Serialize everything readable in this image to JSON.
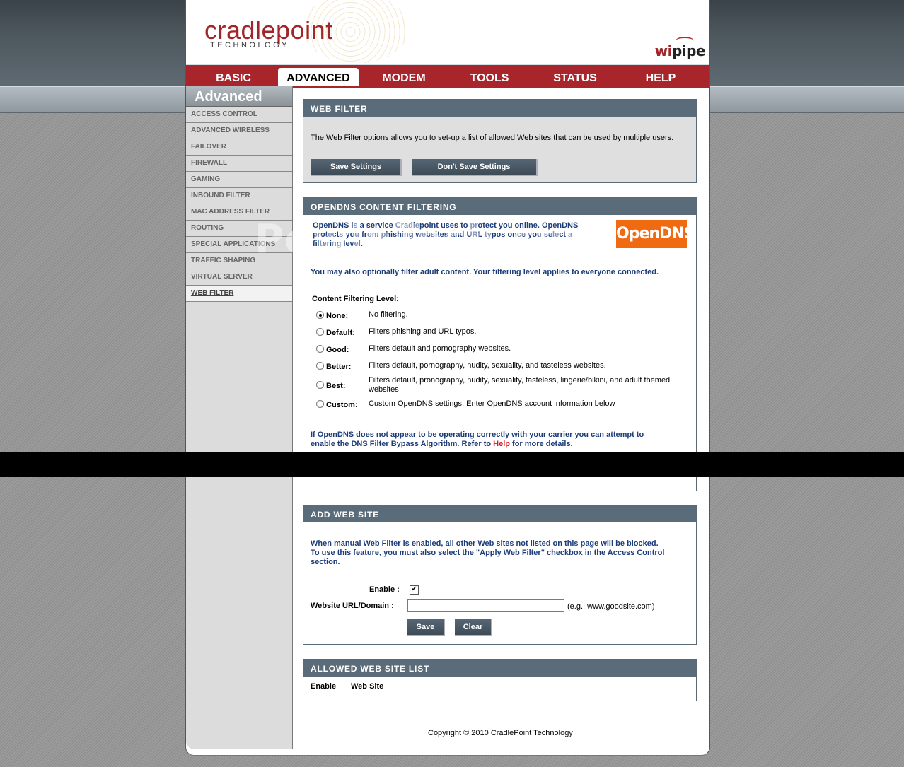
{
  "brand": {
    "logo_main": "cradlepoint",
    "logo_sub": "TECHNOLOGY",
    "product_wi": "wi",
    "product_rest": "pipe"
  },
  "nav": {
    "tabs": [
      "BASIC",
      "ADVANCED",
      "MODEM",
      "TOOLS",
      "STATUS",
      "HELP"
    ],
    "active": "ADVANCED"
  },
  "sidebar": {
    "title": "Advanced",
    "items": [
      "ACCESS CONTROL",
      "ADVANCED WIRELESS",
      "FAILOVER",
      "FIREWALL",
      "GAMING",
      "INBOUND FILTER",
      "MAC ADDRESS FILTER",
      "ROUTING",
      "SPECIAL APPLICATIONS",
      "TRAFFIC SHAPING",
      "VIRTUAL SERVER",
      "WEB FILTER"
    ],
    "current": "WEB FILTER"
  },
  "web_filter": {
    "title": "WEB FILTER",
    "description": "The Web Filter options allows you to set-up a list of allowed Web sites that can be used by multiple users.",
    "save_label": "Save Settings",
    "dont_save_label": "Don't Save Settings"
  },
  "opendns": {
    "title": "OPENDNS CONTENT FILTERING",
    "intro_1": "OpenDNS is a service Cradlepoint uses to protect you online. OpenDNS",
    "intro_2": "protects you from phishing websites and URL typos once you select a",
    "intro_3": "filtering level.",
    "logo_text": "OpenDNS",
    "adult_note": "You may also optionally filter adult content. Your filtering level applies to everyone connected.",
    "level_label": "Content Filtering Level:",
    "levels": [
      {
        "name": "None:",
        "desc": "No filtering.",
        "selected": true
      },
      {
        "name": "Default:",
        "desc": "Filters phishing and URL typos.",
        "selected": false
      },
      {
        "name": "Good:",
        "desc": "Filters default and pornography websites.",
        "selected": false
      },
      {
        "name": "Better:",
        "desc": "Filters default, pornography, nudity, sexuality, and tasteless websites.",
        "selected": false
      },
      {
        "name": "Best:",
        "desc": "Filters default, pronography, nudity, sexuality, tasteless, lingerie/bikini, and adult themed",
        "desc_2": "websites",
        "selected": false
      },
      {
        "name": "Custom:",
        "desc": "Custom OpenDNS settings. Enter OpenDNS account information below",
        "selected": false
      }
    ],
    "bypass_1": "If OpenDNS does not appear to be operating correctly with your carrier you can attempt to",
    "bypass_2_pre": "enable the DNS Filter Bypass Algorithm. Refer to ",
    "bypass_help": "Help",
    "bypass_2_post": " for more details."
  },
  "add_site": {
    "title": "ADD WEB SITE",
    "note_1": "When manual Web Filter is enabled, all other Web sites not listed on this page will be blocked.",
    "note_2": "To use this feature, you must also select the \"Apply Web Filter\" checkbox in the Access Control",
    "note_3": "section.",
    "enable_label": "Enable :",
    "enable_checked": true,
    "url_label": "Website URL/Domain :",
    "url_value": "",
    "url_hint": "(e.g.: www.goodsite.com)",
    "save_label": "Save",
    "clear_label": "Clear"
  },
  "allowed_list": {
    "title": "ALLOWED WEB SITE LIST",
    "col_enable": "Enable",
    "col_site": "Web Site"
  },
  "footer": {
    "copyright": "Copyright © 2010 CradlePoint Technology"
  },
  "watermark": "PowinTech.com",
  "colors": {
    "brand_red": "#a7252b",
    "section_header": "#5a6b79",
    "link_blue": "#1c3c7a",
    "opendns_orange": "#f06a12"
  }
}
